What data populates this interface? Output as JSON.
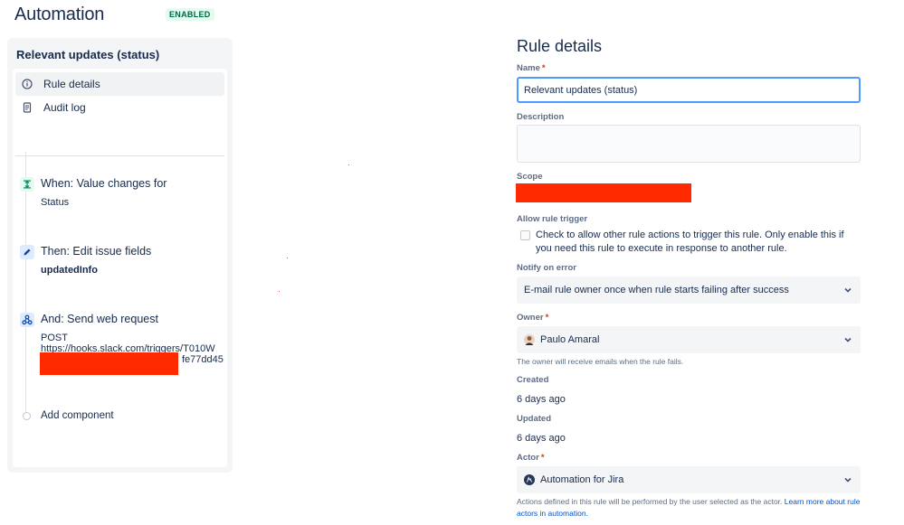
{
  "header": {
    "title": "Automation",
    "status_badge": "ENABLED"
  },
  "sidebar": {
    "title": "Relevant updates (status)",
    "nav": [
      {
        "label": "Rule details",
        "icon": "info-icon",
        "active": true
      },
      {
        "label": "Audit log",
        "icon": "document-icon",
        "active": false
      }
    ],
    "components": [
      {
        "icon": "trigger-icon",
        "title": "When: Value changes for",
        "sub": "Status"
      },
      {
        "icon": "pencil-icon",
        "title": "Then: Edit issue fields",
        "sub": "updatedInfo"
      },
      {
        "icon": "webhook-icon",
        "title": "And: Send web request",
        "method": "POST",
        "url": "https://hooks.slack.com/triggers/T010W",
        "url_tail": "fe77dd45"
      }
    ],
    "add_component": "Add component"
  },
  "details": {
    "title": "Rule details",
    "name_label": "Name",
    "name_value": "Relevant updates (status)",
    "description_label": "Description",
    "description_value": "",
    "scope_label": "Scope",
    "allow_trigger_label": "Allow rule trigger",
    "allow_trigger_text": "Check to allow other rule actions to trigger this rule. Only enable this if you need this rule to execute in response to another rule.",
    "notify_label": "Notify on error",
    "notify_value": "E-mail rule owner once when rule starts failing after success",
    "owner_label": "Owner",
    "owner_value": "Paulo Amaral",
    "owner_help": "The owner will receive emails when the rule fails.",
    "created_label": "Created",
    "created_value": "6 days ago",
    "updated_label": "Updated",
    "updated_value": "6 days ago",
    "actor_label": "Actor",
    "actor_value": "Automation for Jira",
    "actor_help": "Actions defined in this rule will be performed by the user selected as the actor.",
    "actor_link": "Learn more about rule actors in automation."
  },
  "colors": {
    "accent": "#4c9aff",
    "redaction": "#ff2a00",
    "enabled_text": "#006644",
    "enabled_bg": "#e3fcef",
    "link": "#0052cc"
  }
}
